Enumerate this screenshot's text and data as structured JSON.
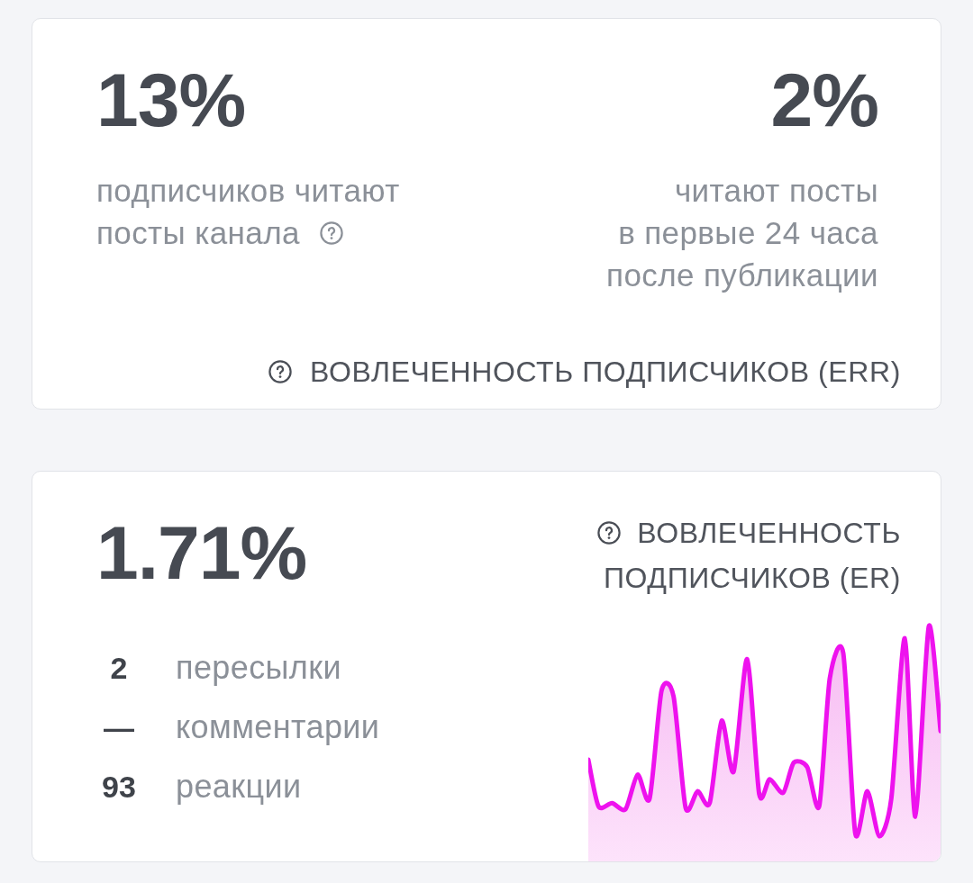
{
  "cards": [
    {
      "kind": "err",
      "left": {
        "value": "13%",
        "caption": [
          "подписчиков читают",
          "посты канала"
        ],
        "help": true
      },
      "right": {
        "value": "2%",
        "caption": [
          "читают посты",
          "в первые 24 часа",
          "после публикации"
        ]
      },
      "footer": {
        "label": "ВОВЛЕЧЕННОСТЬ ПОДПИСЧИКОВ (ERR)",
        "help": true
      }
    },
    {
      "kind": "er",
      "value": "1.71%",
      "stats": [
        {
          "count": "2",
          "label": "пересылки"
        },
        {
          "count": "—",
          "label": "комментарии"
        },
        {
          "count": "93",
          "label": "реакции"
        }
      ],
      "title": {
        "lines": [
          "ВОВЛЕЧЕННОСТЬ",
          "ПОДПИСЧИКОВ (ER)"
        ],
        "help": true
      }
    }
  ]
}
